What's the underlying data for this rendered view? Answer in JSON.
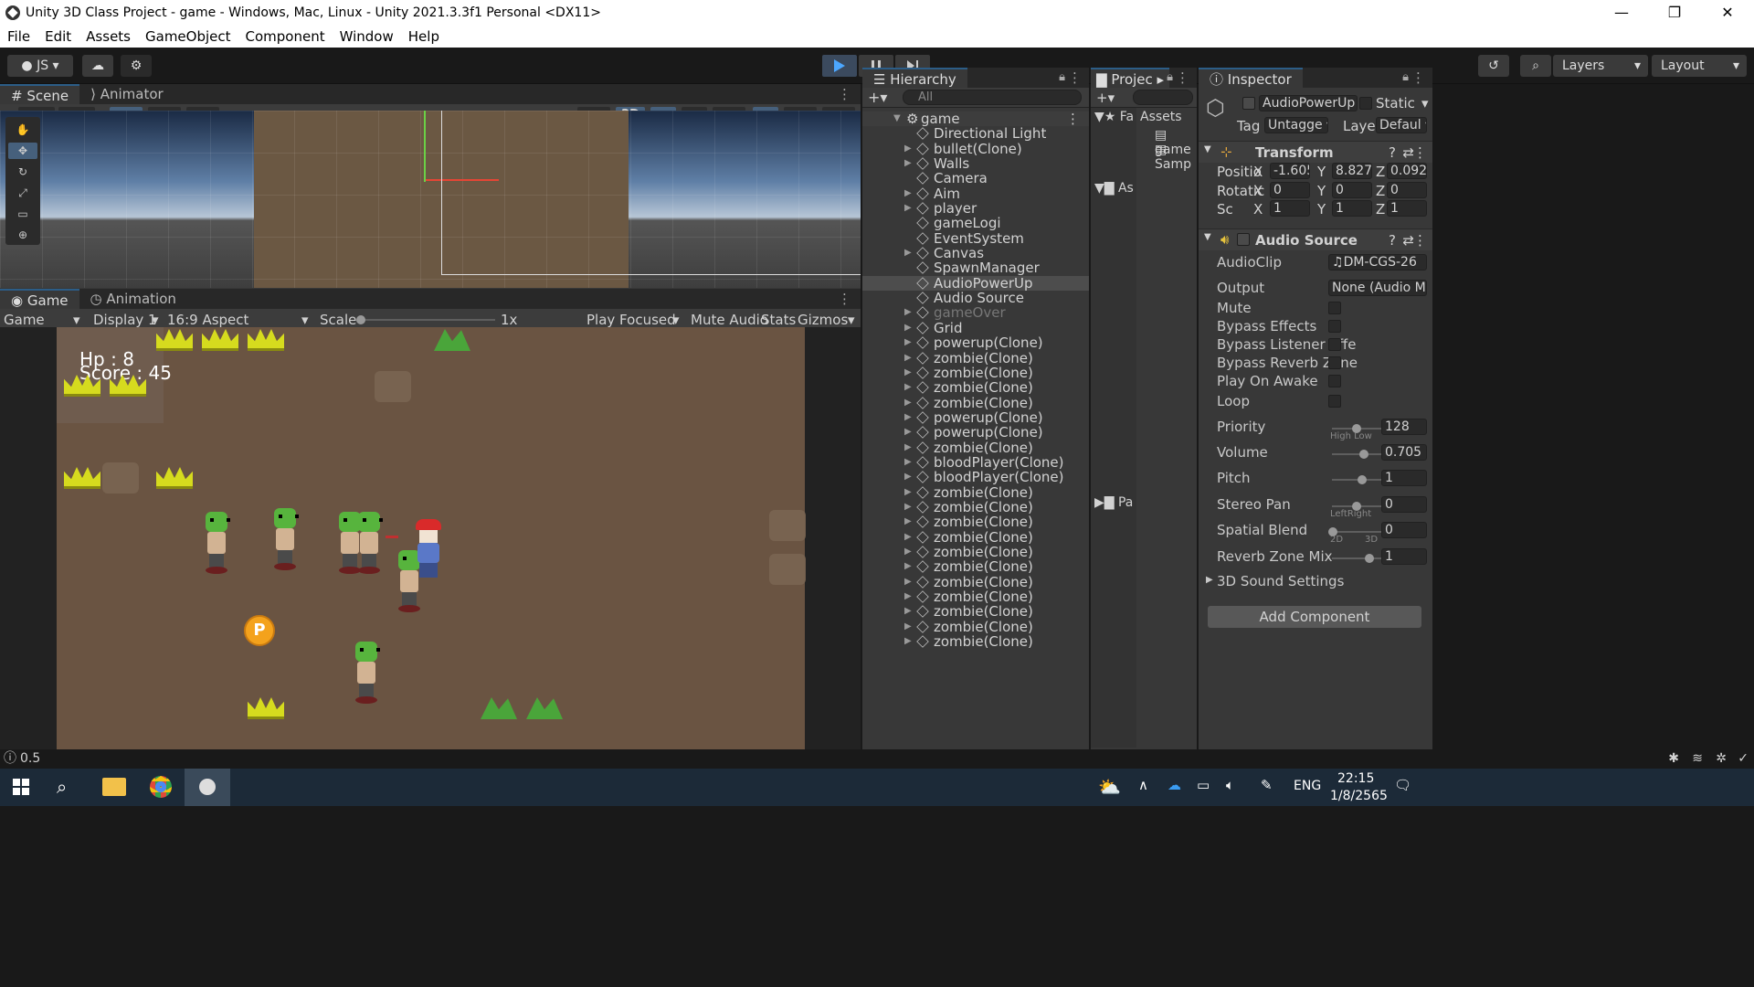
{
  "window": {
    "title": "Unity 3D Class Project - game - Windows, Mac, Linux - Unity 2021.3.3f1 Personal <DX11>",
    "minimize": "—",
    "maximize": "❐",
    "close": "✕"
  },
  "menu": [
    "File",
    "Edit",
    "Assets",
    "GameObject",
    "Component",
    "Window",
    "Help"
  ],
  "toolbar": {
    "account": "JS",
    "layers": "Layers",
    "layout": "Layout"
  },
  "scene": {
    "tab_scene": "Scene",
    "tab_animator": "Animator",
    "mode_2d": "2D"
  },
  "game": {
    "tab_game": "Game",
    "tab_animation": "Animation",
    "display_mode": "Game",
    "display": "Display 1",
    "aspect": "16:9 Aspect",
    "scale_label": "Scale",
    "scale_value": "1x",
    "play_focused": "Play Focused",
    "mute_audio": "Mute Audio",
    "stats": "Stats",
    "gizmos": "Gizmos",
    "hp_text": "Hp : 8",
    "score_text": "Score : 45",
    "coin_letter": "P"
  },
  "hierarchy": {
    "title": "Hierarchy",
    "search_placeholder": "All",
    "root": "game",
    "items": [
      "Directional Light",
      "bullet(Clone)",
      "Walls",
      "Camera",
      "Aim",
      "player",
      "gameLogi",
      "EventSystem",
      "Canvas",
      "SpawnManager",
      "AudioPowerUp",
      "Audio Source",
      "gameOver",
      "Grid",
      "powerup(Clone)",
      "zombie(Clone)",
      "zombie(Clone)",
      "zombie(Clone)",
      "zombie(Clone)",
      "powerup(Clone)",
      "powerup(Clone)",
      "zombie(Clone)",
      "bloodPlayer(Clone)",
      "bloodPlayer(Clone)",
      "zombie(Clone)",
      "zombie(Clone)",
      "zombie(Clone)",
      "zombie(Clone)",
      "zombie(Clone)",
      "zombie(Clone)",
      "zombie(Clone)",
      "zombie(Clone)",
      "zombie(Clone)",
      "zombie(Clone)",
      "zombie(Clone)"
    ],
    "selected": "AudioPowerUp",
    "disabled": "gameOver"
  },
  "project": {
    "title": "Projec",
    "favorites": "Fa",
    "assets_crumb": "Assets",
    "as": "As",
    "pa": "Pa",
    "file1": "game",
    "file2": "Samp"
  },
  "inspector": {
    "title": "Inspector",
    "object_name": "AudioPowerUp",
    "static_label": "Static",
    "tag_label": "Tag",
    "tag_value": "Untagge",
    "layer_label": "Layer",
    "layer_value": "Defaul",
    "transform": {
      "title": "Transform",
      "pos_label": "Positio",
      "rot_label": "Rotatic",
      "scale_label": "Sc",
      "x": "X",
      "y": "Y",
      "z": "Z",
      "pos": [
        "-1.605",
        "8.8272",
        "0.0926"
      ],
      "rot": [
        "0",
        "0",
        "0"
      ],
      "scale": [
        "1",
        "1",
        "1"
      ]
    },
    "audio": {
      "title": "Audio Source",
      "clip_label": "AudioClip",
      "clip_value": "DM-CGS-26",
      "output_label": "Output",
      "output_value": "None (Audio M",
      "mute": "Mute",
      "bypass_effects": "Bypass Effects",
      "bypass_listener": "Bypass Listener Effe",
      "bypass_reverb": "Bypass Reverb Zone",
      "play_on_awake": "Play On Awake",
      "loop": "Loop",
      "priority_label": "Priority",
      "priority": "128",
      "priority_low": "High Low",
      "volume_label": "Volume",
      "volume": "0.705",
      "pitch_label": "Pitch",
      "pitch": "1",
      "stereo_label": "Stereo Pan",
      "stereo": "0",
      "stereo_sub": "LeftRight",
      "spatial_label": "Spatial Blend",
      "spatial": "0",
      "spatial_2d": "2D",
      "spatial_3d": "3D",
      "reverb_label": "Reverb Zone Mix",
      "reverb": "1",
      "sound3d": "3D Sound Settings"
    },
    "add_component": "Add Component"
  },
  "status": {
    "value": "0.5"
  },
  "taskbar": {
    "lang": "ENG",
    "time": "22:15",
    "date": "1/8/2565"
  }
}
